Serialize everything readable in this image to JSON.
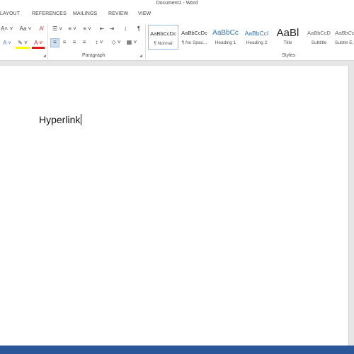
{
  "window": {
    "title": "Document1 - Word"
  },
  "tabs": [
    "LAYOUT",
    "REFERENCES",
    "MAILINGS",
    "REVIEW",
    "VIEW"
  ],
  "ribbon": {
    "font": {
      "grow_font": "A˄",
      "shrink_font": "˅",
      "change_case": "Aa ˅",
      "clear_formatting": "A̸",
      "text_effects": "A ˅",
      "highlight": "✎ ˅",
      "font_color": "A ˅"
    },
    "paragraph": {
      "group_label": "Paragraph",
      "bullets": "☰ ˅",
      "numbering": "≡ ˅",
      "multilevel": "≡ ˅",
      "decrease_indent": "⇤",
      "increase_indent": "⇥",
      "sort": "↕",
      "show_marks": "¶",
      "align_left": "≡",
      "align_center": "≡",
      "align_right": "≡",
      "justify": "≡",
      "line_spacing": "↕ ˅",
      "shading": "◇ ˅",
      "borders": "▦ ˅",
      "launcher": "◢"
    },
    "styles": {
      "group_label": "Styles",
      "items": [
        {
          "sample": "AaBbCcDc",
          "name": "¶ Normal"
        },
        {
          "sample": "AaBbCcDc",
          "name": "¶ No Spac..."
        },
        {
          "sample": "AaBbCc",
          "name": "Heading 1"
        },
        {
          "sample": "AaBbCcI",
          "name": "Heading 2"
        },
        {
          "sample": "AaBl",
          "name": "Title"
        },
        {
          "sample": "AaBbCcD",
          "name": "Subtitle"
        },
        {
          "sample": "AaBbCcI",
          "name": "Subtle E..."
        }
      ],
      "launcher": "◢"
    }
  },
  "document": {
    "text": "Hyperlink"
  },
  "colors": {
    "accent": "#2b579a",
    "highlight_yellow": "#ffff00",
    "font_red": "#e11b1b",
    "heading_blue": "#2e74b5"
  }
}
